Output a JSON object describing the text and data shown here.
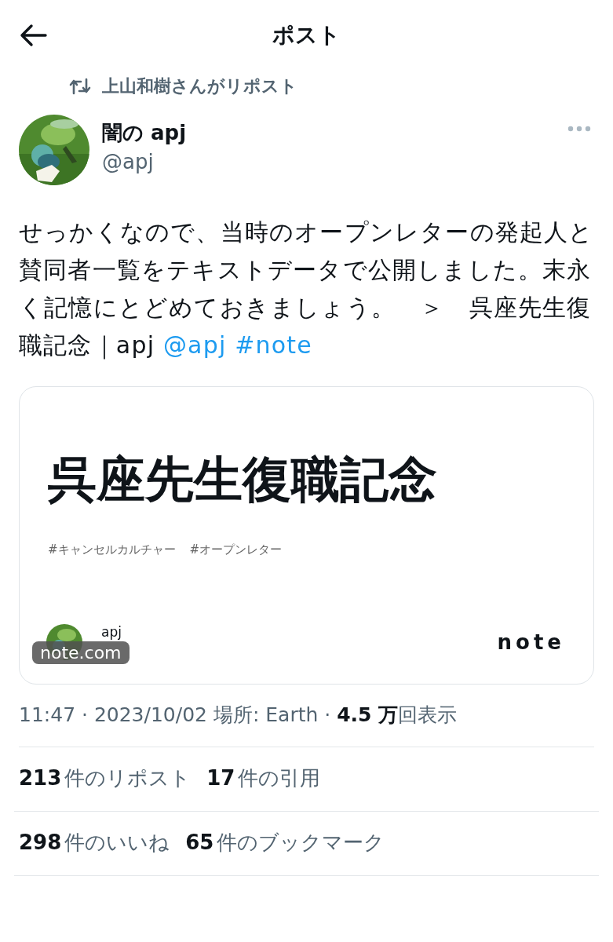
{
  "header": {
    "title": "ポスト"
  },
  "repost": {
    "label": "上山和樹さんがリポスト"
  },
  "author": {
    "name": "闇の apj",
    "handle": "@apj"
  },
  "body": {
    "text": "せっかくなので、当時のオープンレターの発起人と賛同者一覧をテキストデータで公開しました。末永く記憶にとどめておきましょう。　＞　呉座先生復職記念｜apj",
    "mention": "@apj",
    "hashtag": "#note"
  },
  "card": {
    "title": "呉座先生復職記念",
    "tags": [
      "#キャンセルカルチャー",
      "#オープンレター"
    ],
    "author": "apj",
    "logo": "note",
    "domain": "note.com"
  },
  "meta": {
    "text": "11:47 · 2023/10/02 場所: Earth · **4.5 万**回表示"
  },
  "stats": [
    {
      "count": "213",
      "label": "件のリポスト"
    },
    {
      "count": "17",
      "label": "件の引用"
    },
    {
      "count": "298",
      "label": "件のいいね"
    },
    {
      "count": "65",
      "label": "件のブックマーク"
    }
  ]
}
